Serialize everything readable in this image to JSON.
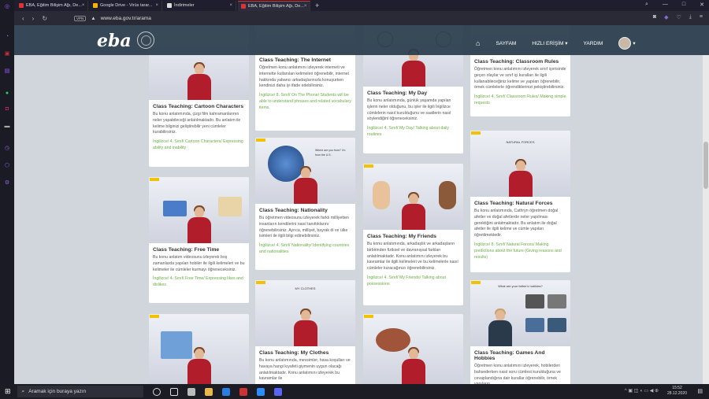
{
  "browser": {
    "tabs": [
      {
        "label": "EBA, Eğitim Bilişim Ağı, De...",
        "color": "#d33",
        "active": false
      },
      {
        "label": "Google Drive - Virüs tarar...",
        "color": "#f4b400",
        "active": false
      },
      {
        "label": "İndirimeler",
        "color": "#fff",
        "active": false
      },
      {
        "label": "EBA, Eğitim Bilişim Ağı, De...",
        "color": "#d33",
        "active": true
      }
    ],
    "url": "www.eba.gov.tr/arama",
    "vpn": "VPN"
  },
  "site": {
    "logo": "eba",
    "nav": {
      "home_icon": "home-icon",
      "page": "SAYFAM",
      "quick": "HIZLI ERİŞİM",
      "help": "YARDIM"
    }
  },
  "cards": [
    {
      "title": "Class Teaching: Cartoon Characters",
      "desc": "Bu konu anlatımında, çizgi film kahramanlarının neler yapabileceği anlatılmaktadır. Bu anlatım ile kelime bilginizi geliştirebilir yeni cümleler kurabilirsiniz.",
      "link": "İngilizce/ 4. Sınıf/ Cartoon Characters/ Expressing ability and inability"
    },
    {
      "title": "Class Teaching: Free Time",
      "desc": "Bu konu anlatım videosunu izleyerek boş zamanlarda yapılan hobiler ile ilgili kelimeleri ve bu kelimeler ile cümleler kurmayı öğreneceksiniz.",
      "link": "İngilizce/ 4. Sınıf/ Free Time/ Expressing likes and dislikes"
    },
    {
      "title": "Class Teaching: The Internet",
      "desc": "Öğretmen konu anlatımını izleyerek interneti ve internette kullanılan kelimeleri öğrenebilir, internet hakkında yabancı arkadaşlarınızla konuşurken kendinizi daha iyi ifade edebilirsiniz.",
      "link": "İngilizce/ 8. Sınıf/ On The Phone/ Students will be able to understand phrases and related vocabulary items."
    },
    {
      "title": "Class Teaching: Nationality",
      "desc": "Bu öğretmen videosunu izleyerek farklı milliyetten insanların kendilerini nasıl tanıttıklarını öğrenebilirsiniz. Ayrıca, milliyet, bayrak di ve ülke isimleri ile ilgili bilgi edinebilirsiniz.",
      "link": "İngilizce/ 4. Sınıf/ Nationality/ Identifying countries and nationalities"
    },
    {
      "title": "Class Teaching: My Clothes",
      "desc": "Bu konu anlatımında, mevsimler, hava koşulları ve havaya hangi kıyafeti giymenin uygun olacağı anlatılmaktadır. Konu anlatımını izleyerek bu kavramlar ile",
      "link": ""
    },
    {
      "title": "Class Teaching: My Day",
      "desc": "Bu konu anlatımında, günlük yaşamda yapılan işlerin neler olduğunu, bu işler ile ilgili İngilizce cümlelerin nasıl kurulduğunu ve saatlerin nasıl söylendiğini öğreneceksiniz.",
      "link": "İngilizce/ 4. Sınıf/ My Day/ Talking about daily routines"
    },
    {
      "title": "Class Teaching: My Friends",
      "desc": "Bu konu anlatımında, arkadaşlık ve arkadaşların birbirinden fiziksel ve davranışsal farkları anlatılmaktadır. Konu anlatımını izleyerek bu kavramlar ile ilgili kelimeleri ve bu kelimelerle nasıl cümleler kuracağınızı öğrenebilirsiniz.",
      "link": "İngilizce/ 4. Sınıf/ My Friends/ Talking about possessions"
    },
    {
      "title": "Class Teaching: Classroom Rules",
      "desc": "Öğretmen konu anlatımını izleyerek sınıf içerisinde geçen olaylar ve sınıf içi kuralları ile ilgili kullanabileceğiniz kelime ve yapıları öğrenebilir, örnek cümlelerle öğrendiklerinizi pekiştirebilirsiniz.",
      "link": "İngilizce/ 4. Sınıf/ Classroom Rules/ Making simple requests"
    },
    {
      "title": "Class Teaching: Natural Forces",
      "desc": "Bu konu anlatımında, Cathryn öğretmen doğal afetler ve doğal afetlerde neler yapılması gerektiğini anlatmaktadır. Bu anlatım ile doğal afetler ile ilgili kelime ve cümle yapıları öğretilmektedir.",
      "link": "İngilizce/ 8. Sınıf/ Natural Forces/ Making predictions about the future (Giving reasons and results)",
      "thumb_text": "NATURAL FORCES"
    },
    {
      "title": "Class Teaching: Games And Hobbies",
      "desc": "Öğretmen konu anlatımını izleyerek, hobilerden bahsederken nasıl soru cümlesi kurulduğuna ve cevaplandığına dair kurallar öğrenebilir, örnek yapıların",
      "link": "",
      "thumb_text": "What are your father's hobbies?"
    }
  ],
  "thumb_labels": {
    "clothes": "MY CLOTHES",
    "nationality": "Where are you from? I'm from the U.S."
  },
  "taskbar": {
    "search": "Aramak için buraya yazın",
    "time": "15:52",
    "date": "28.12.2020"
  }
}
